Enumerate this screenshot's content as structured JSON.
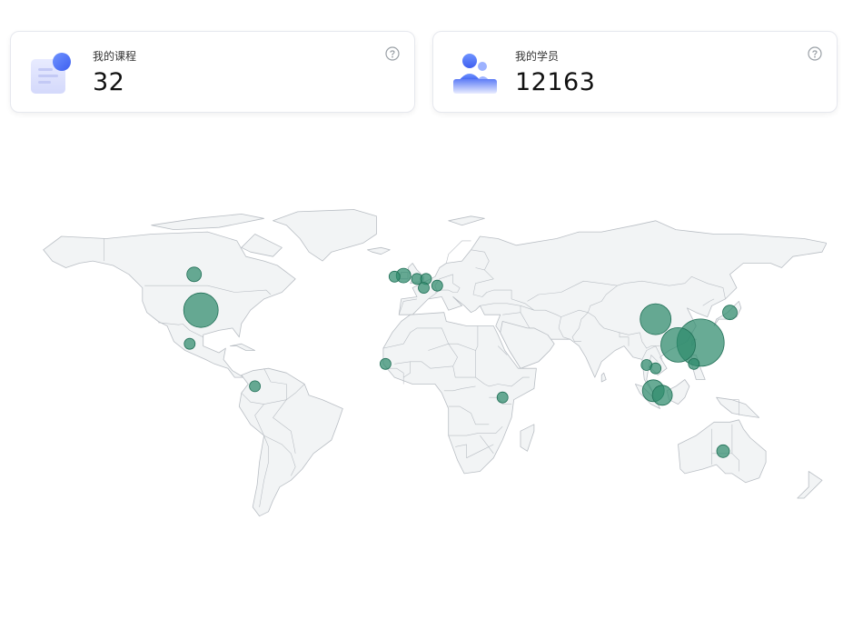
{
  "cards": [
    {
      "label": "我的课程",
      "value": "32",
      "icon": "book-icon",
      "help_icon": "question-circle-icon"
    },
    {
      "label": "我的学员",
      "value": "12163",
      "icon": "students-icon",
      "help_icon": "question-circle-icon"
    }
  ],
  "map": {
    "type": "bubble-map",
    "projection": "world",
    "land_color": "#f2f4f5",
    "border_color": "#b9bec4",
    "bubble_color": "#2e8b6c",
    "bubbles": [
      {
        "lon": 124,
        "lat": 23.5,
        "r": 26
      },
      {
        "lon": 114,
        "lat": 22.5,
        "r": 19
      },
      {
        "lon": 104,
        "lat": 34,
        "r": 17
      },
      {
        "lon": -98,
        "lat": 38,
        "r": 19
      },
      {
        "lon": 103,
        "lat": 2,
        "r": 12
      },
      {
        "lon": 107,
        "lat": 0,
        "r": 11
      },
      {
        "lon": 137,
        "lat": 37,
        "r": 8
      },
      {
        "lon": -101,
        "lat": 54,
        "r": 8
      },
      {
        "lon": -74,
        "lat": 4,
        "r": 6
      },
      {
        "lon": -103,
        "lat": 23,
        "r": 6
      },
      {
        "lon": -8,
        "lat": 53.5,
        "r": 8
      },
      {
        "lon": -12,
        "lat": 53,
        "r": 6
      },
      {
        "lon": -2,
        "lat": 52,
        "r": 6
      },
      {
        "lon": 2,
        "lat": 52,
        "r": 6
      },
      {
        "lon": 1,
        "lat": 48,
        "r": 6
      },
      {
        "lon": 7,
        "lat": 49,
        "r": 6
      },
      {
        "lon": -16,
        "lat": 14,
        "r": 6
      },
      {
        "lon": 36,
        "lat": -1,
        "r": 6
      },
      {
        "lon": 100,
        "lat": 13.5,
        "r": 6
      },
      {
        "lon": 104,
        "lat": 12,
        "r": 6
      },
      {
        "lon": 121,
        "lat": 14,
        "r": 6
      },
      {
        "lon": 134,
        "lat": -25,
        "r": 7
      }
    ]
  }
}
